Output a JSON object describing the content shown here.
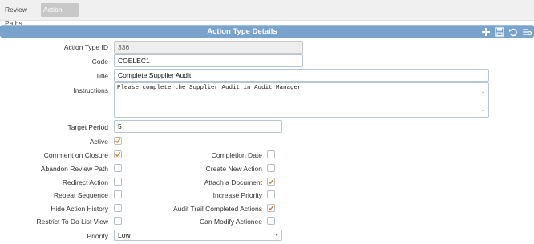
{
  "tabs": [
    "Review Paths",
    "Action Types"
  ],
  "header": {
    "title": "Action Type Details"
  },
  "icons": [
    "plus-icon",
    "save-icon",
    "undo-icon",
    "list-settings-icon"
  ],
  "fields": {
    "action_type_id": {
      "label": "Action Type ID",
      "value": "336"
    },
    "code": {
      "label": "Code",
      "value": "COELEC1"
    },
    "title": {
      "label": "Title",
      "value": "Complete Supplier Audit"
    },
    "instructions": {
      "label": "Instructions",
      "value": "Please complete the Supplier Audit in Audit Manager"
    },
    "target_period": {
      "label": "Target Period",
      "value": "5"
    },
    "priority": {
      "label": "Priority",
      "value": "Low"
    }
  },
  "checkboxes_left": [
    {
      "label": "Active",
      "checked": true
    },
    {
      "label": "Comment on Closure",
      "checked": true
    },
    {
      "label": "Abandon Review Path",
      "checked": false
    },
    {
      "label": "Redirect Action",
      "checked": false
    },
    {
      "label": "Repeat Sequence",
      "checked": false
    },
    {
      "label": "Hide Action History",
      "checked": false
    },
    {
      "label": "Restrict To Do List View",
      "checked": false
    }
  ],
  "checkboxes_right": [
    {
      "label": "Completion Date",
      "checked": false
    },
    {
      "label": "Create New Action",
      "checked": false
    },
    {
      "label": "Attach a Document",
      "checked": true
    },
    {
      "label": "Increase Priority",
      "checked": false
    },
    {
      "label": "Audit Trail Completed Actions",
      "checked": true
    },
    {
      "label": "Can Modify Actionee",
      "checked": false
    }
  ],
  "colors": {
    "header": "#7aa3cc",
    "check": "#e07b20",
    "tab_active": "#c8c8c8"
  }
}
